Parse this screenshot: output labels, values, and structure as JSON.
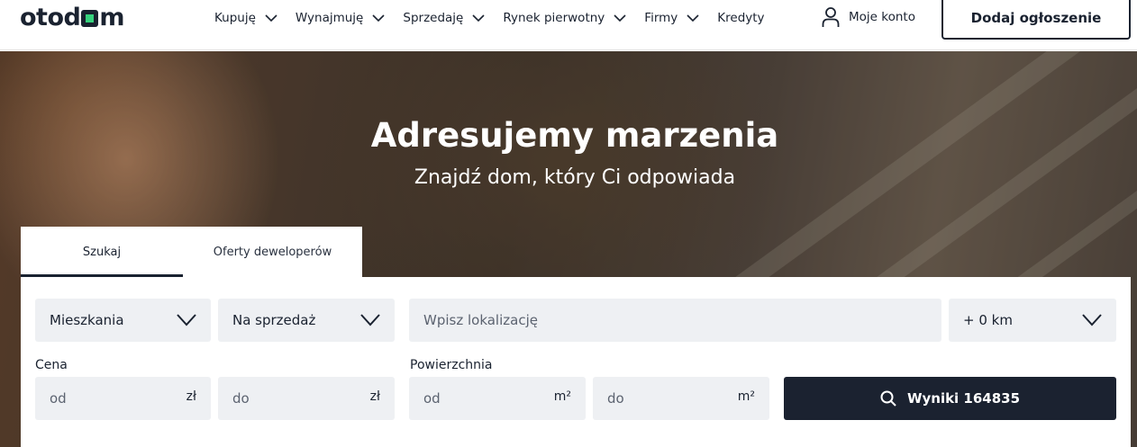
{
  "header": {
    "logo": "otodom",
    "nav": [
      {
        "label": "Kupuję",
        "has_dropdown": true
      },
      {
        "label": "Wynajmuję",
        "has_dropdown": true
      },
      {
        "label": "Sprzedaję",
        "has_dropdown": true
      },
      {
        "label": "Rynek pierwotny",
        "has_dropdown": true
      },
      {
        "label": "Firmy",
        "has_dropdown": true
      },
      {
        "label": "Kredyty",
        "has_dropdown": false
      }
    ],
    "account_label": "Moje konto",
    "account_icon": "user-icon",
    "add_listing_label": "Dodaj ogłoszenie"
  },
  "hero": {
    "title": "Adresujemy marzenia",
    "subtitle": "Znajdź dom, który Ci odpowiada"
  },
  "tabs": [
    {
      "label": "Szukaj",
      "active": true
    },
    {
      "label": "Oferty deweloperów",
      "active": false
    }
  ],
  "search": {
    "property_type": "Mieszkania",
    "transaction_type": "Na sprzedaż",
    "location_placeholder": "Wpisz lokalizację",
    "distance": "+ 0 km",
    "price_label": "Cena",
    "price_from_placeholder": "od",
    "price_to_placeholder": "do",
    "price_unit": "zł",
    "area_label": "Powierzchnia",
    "area_from_placeholder": "od",
    "area_to_placeholder": "do",
    "area_unit": "m²",
    "results_label": "Wyniki 164835",
    "results_icon": "search-icon"
  },
  "colors": {
    "brand_dark": "#1b2230",
    "brand_green": "#36d27d",
    "field_bg": "#eef0f3"
  }
}
